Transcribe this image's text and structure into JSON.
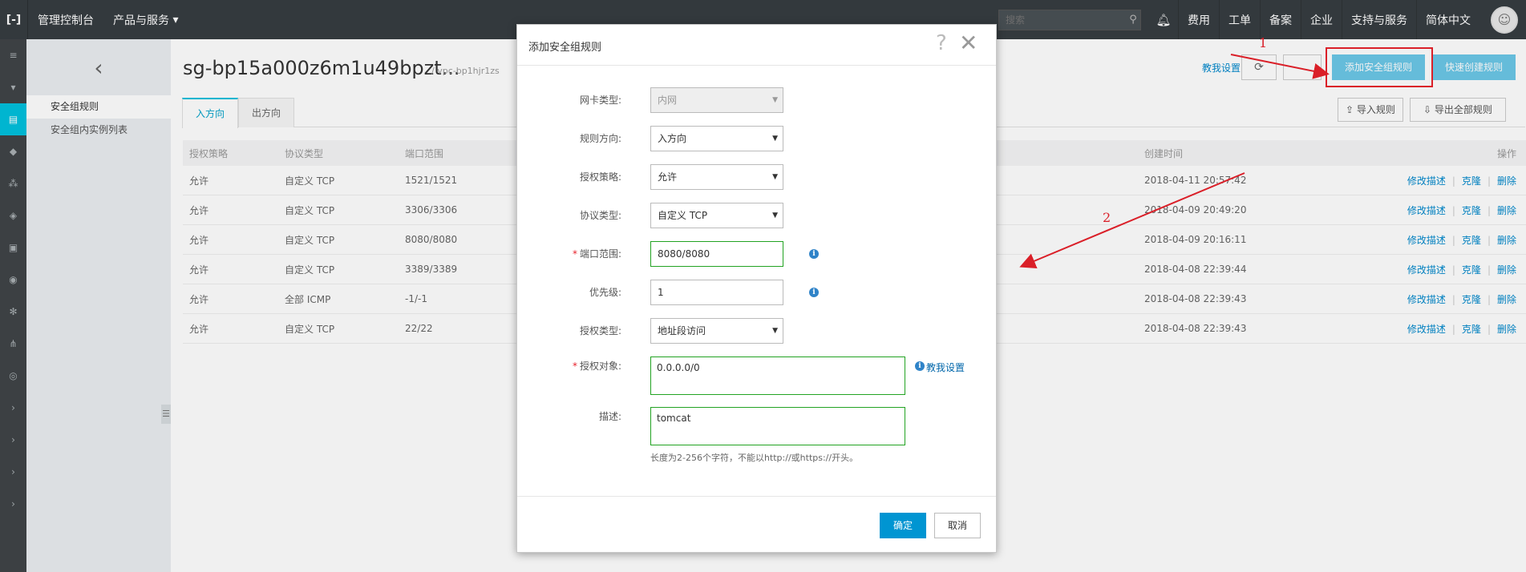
{
  "topbar": {
    "logo": "[-]",
    "console": "管理控制台",
    "products": "产品与服务",
    "products_caret": "▾",
    "search_placeholder": "搜索",
    "items": [
      "费用",
      "工单",
      "备案",
      "企业",
      "支持与服务",
      "简体中文"
    ]
  },
  "sidebar": {
    "back": "‹",
    "items": [
      "安全组规则",
      "安全组内实例列表"
    ]
  },
  "page": {
    "title": "sg-bp15a000z6m1u49bpzt...",
    "meta": "/ vpc-bp1hjr1zs",
    "teach_link": "教我设置",
    "refresh": "⟳",
    "add_rule": "添加安全组规则",
    "quick_rule": "快速创建规则",
    "import_rules": "导入规则",
    "export_all": "导出全部规则",
    "tabs": [
      "入方向",
      "出方向"
    ]
  },
  "table": {
    "headers": [
      "授权策略",
      "协议类型",
      "端口范围",
      "创建时间",
      "操作"
    ],
    "actions": [
      "修改描述",
      "克隆",
      "删除"
    ],
    "rows": [
      {
        "policy": "允许",
        "protocol": "自定义 TCP",
        "port": "1521/1521",
        "time": "2018-04-11 20:57:42"
      },
      {
        "policy": "允许",
        "protocol": "自定义 TCP",
        "port": "3306/3306",
        "time": "2018-04-09 20:49:20"
      },
      {
        "policy": "允许",
        "protocol": "自定义 TCP",
        "port": "8080/8080",
        "time": "2018-04-09 20:16:11"
      },
      {
        "policy": "允许",
        "protocol": "自定义 TCP",
        "port": "3389/3389",
        "time": "2018-04-08 22:39:44"
      },
      {
        "policy": "允许",
        "protocol": "全部 ICMP",
        "port": "-1/-1",
        "time": "2018-04-08 22:39:43"
      },
      {
        "policy": "允许",
        "protocol": "自定义 TCP",
        "port": "22/22",
        "time": "2018-04-08 22:39:43"
      }
    ]
  },
  "annotations": {
    "one": "1",
    "two": "2"
  },
  "modal": {
    "title": "添加安全组规则",
    "help": "?",
    "close": "✕",
    "nic_label": "网卡类型:",
    "nic_value": "内网",
    "direction_label": "规则方向:",
    "direction_value": "入方向",
    "policy_label": "授权策略:",
    "policy_value": "允许",
    "protocol_label": "协议类型:",
    "protocol_value": "自定义 TCP",
    "port_label": "端口范围:",
    "port_value": "8080/8080",
    "priority_label": "优先级:",
    "priority_value": "1",
    "auth_type_label": "授权类型:",
    "auth_type_value": "地址段访问",
    "auth_obj_label": "授权对象:",
    "auth_obj_value": "0.0.0.0/0",
    "teach_me": "教我设置",
    "desc_label": "描述:",
    "desc_value": "tomcat",
    "hint": "长度为2-256个字符，不能以http://或https://开头。",
    "required_mark": "*",
    "ok": "确定",
    "cancel": "取消"
  },
  "colors": {
    "accent": "#00c1de",
    "primary_button": "#0095d2",
    "annotation": "#e8212b"
  }
}
